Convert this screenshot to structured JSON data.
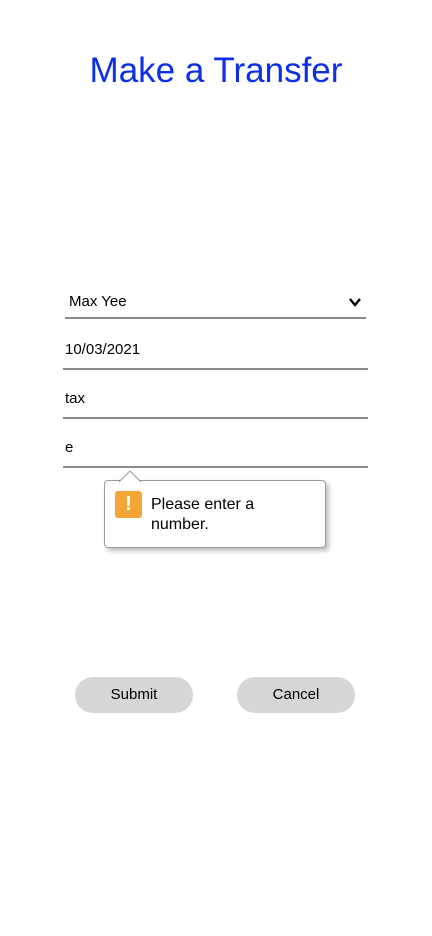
{
  "page": {
    "title": "Make a Transfer"
  },
  "form": {
    "recipient": {
      "selected": "Max Yee",
      "icon": "chevron-down-icon"
    },
    "date": {
      "value": "10/03/2021"
    },
    "description": {
      "value": "tax"
    },
    "amount": {
      "value": "e"
    }
  },
  "validation": {
    "message": "Please enter a number.",
    "icon": "warning-icon",
    "icon_glyph": "!",
    "icon_color": "#f3a535"
  },
  "actions": {
    "submit_label": "Submit",
    "cancel_label": "Cancel"
  },
  "colors": {
    "title": "#0b2fe6",
    "button_bg": "#d6d6d6",
    "underline": "#8a8a8a"
  }
}
